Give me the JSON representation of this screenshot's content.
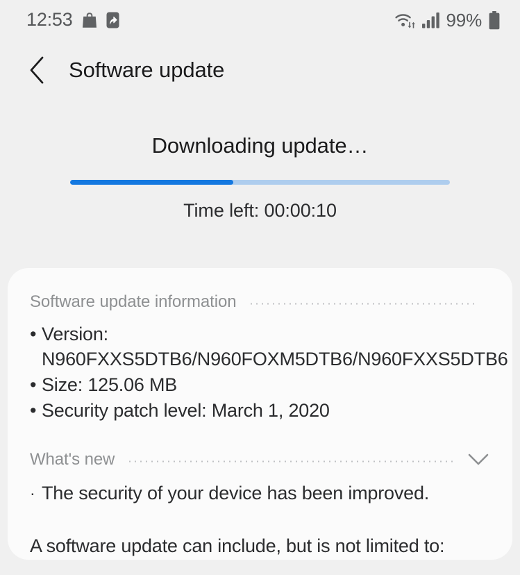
{
  "status_bar": {
    "time": "12:53",
    "battery_percent": "99%",
    "icons": [
      "shopping-bag-icon",
      "smart-switch-icon",
      "wifi-transfer-icon",
      "cellular-signal-icon",
      "battery-icon"
    ]
  },
  "app_bar": {
    "back_icon": "chevron-left-icon",
    "title": "Software update"
  },
  "progress": {
    "status_text": "Downloading update…",
    "percent": 43,
    "time_left_text": "Time left: 00:00:10",
    "fill_color": "#1478e0",
    "track_color": "#aecdee"
  },
  "info_section": {
    "heading": "Software update information",
    "items": [
      {
        "mark": "•",
        "text": "Version: N960FXXS5DTB6/N960FOXM5DTB6/N960FXXS5DTB6"
      },
      {
        "mark": "•",
        "text": "Size: 125.06 MB"
      },
      {
        "mark": "•",
        "text": "Security patch level: March 1, 2020"
      }
    ]
  },
  "whats_new_section": {
    "heading": "What's new",
    "expand_icon": "chevron-down-icon",
    "note_mark": "·",
    "note_text": "The security of your device has been improved.",
    "paragraph": "A software update can include, but is not limited to:"
  }
}
